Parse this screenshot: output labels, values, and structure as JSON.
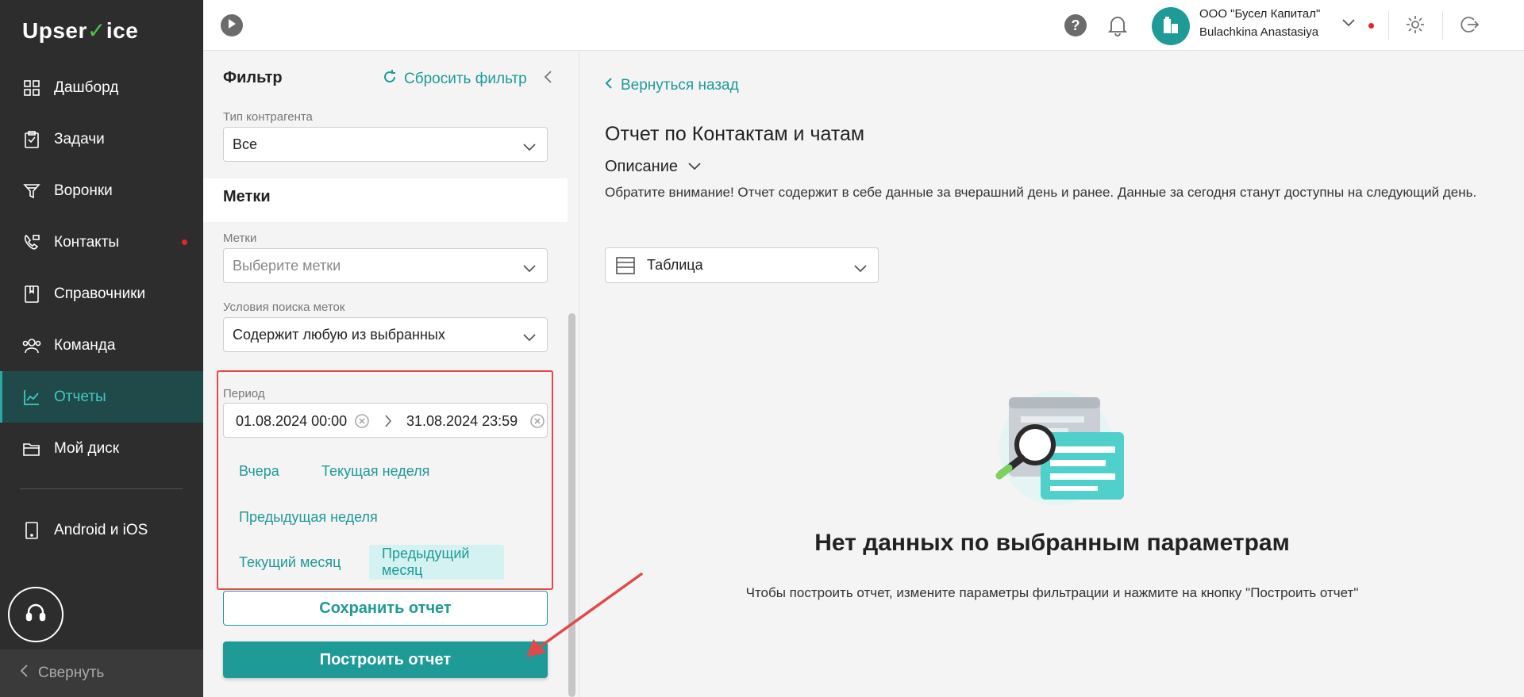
{
  "app": {
    "logo_prefix": "Upser",
    "logo_check": "✓",
    "logo_suffix": "ice"
  },
  "sidebar": {
    "items": [
      {
        "label": "Дашборд",
        "icon": "dashboard-icon"
      },
      {
        "label": "Задачи",
        "icon": "tasks-icon"
      },
      {
        "label": "Воронки",
        "icon": "funnel-icon"
      },
      {
        "label": "Контакты",
        "icon": "contacts-icon",
        "badge": true
      },
      {
        "label": "Справочники",
        "icon": "book-icon"
      },
      {
        "label": "Команда",
        "icon": "team-icon"
      },
      {
        "label": "Отчеты",
        "icon": "reports-icon",
        "active": true
      },
      {
        "label": "Мой диск",
        "icon": "folder-icon"
      },
      {
        "label": "Android и iOS",
        "icon": "phone-icon"
      }
    ],
    "collapse_label": "Свернуть"
  },
  "header": {
    "company": "ООО \"Бусел Капитал\"",
    "user": "Bulachkina Anastasiya",
    "help_label": "?"
  },
  "filter": {
    "title": "Фильтр",
    "reset_label": "Сбросить фильтр",
    "counterparty_type": {
      "label": "Тип контрагента",
      "value": "Все"
    },
    "tags_section_title": "Метки",
    "tags": {
      "label": "Метки",
      "placeholder": "Выберите метки"
    },
    "tag_conditions": {
      "label": "Условия поиска меток",
      "value": "Содержит любую из выбранных"
    },
    "period": {
      "label": "Период",
      "from": "01.08.2024 00:00",
      "to": "31.08.2024 23:59",
      "presets": [
        {
          "label": "Вчера"
        },
        {
          "label": "Текущая неделя"
        },
        {
          "label": "Предыдущая неделя"
        },
        {
          "label": "Текущий месяц"
        },
        {
          "label": "Предыдущий месяц",
          "selected": true
        }
      ]
    },
    "save_label": "Сохранить отчет",
    "build_label": "Построить отчет"
  },
  "main": {
    "back_label": "Вернуться назад",
    "title": "Отчет по Контактам и чатам",
    "description_toggle": "Описание",
    "description": "Обратите внимание! Отчет содержит в себе данные за вчерашний день и ранее. Данные за сегодня станут доступны на следующий день.",
    "view_mode": "Таблица",
    "empty_title": "Нет данных по выбранным параметрам",
    "empty_subtitle": "Чтобы построить отчет, измените параметры фильтрации и нажмите на кнопку \"Построить отчет\""
  },
  "colors": {
    "accent": "#1e9a97",
    "sidebar_bg": "#2d2d2d",
    "annotation": "#e04a4a",
    "badge": "#e02828"
  }
}
